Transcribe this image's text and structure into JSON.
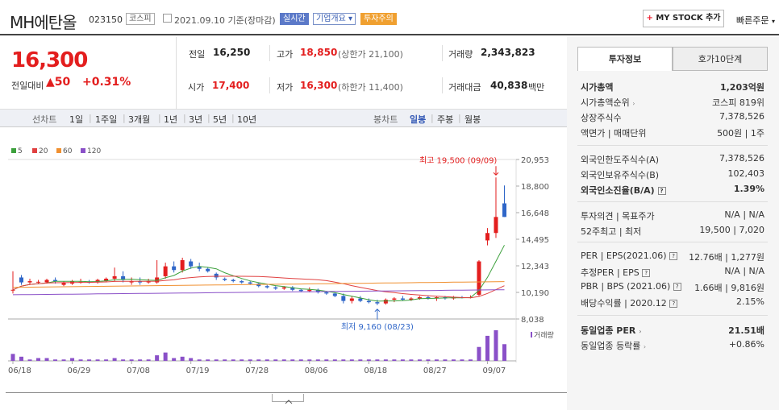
{
  "header": {
    "title": "MH에탄올",
    "code": "023150",
    "market": "코스피",
    "date": "2021.09.10 기준(장마감)",
    "realtime": "실시간",
    "corp_info": "기업개요",
    "caution": "투자주의",
    "mystock_plus": "+",
    "mystock": "MY STOCK 추가",
    "quick_order": "빠른주문"
  },
  "price": {
    "current": "16,300",
    "change_label": "전일대비",
    "change_arrow": "▲",
    "change": "50",
    "change_pct": "+0.31%"
  },
  "quote": {
    "prev_label": "전일",
    "prev": "16,250",
    "high_label": "고가",
    "high": "18,850",
    "high_sub": "(상한가 21,100)",
    "vol_label": "거래량",
    "vol": "2,343,823",
    "open_label": "시가",
    "open": "17,400",
    "low_label": "저가",
    "low": "16,300",
    "low_sub": "(하한가 11,400)",
    "amt_label": "거래대금",
    "amt": "40,838",
    "amt_unit": "백만"
  },
  "periods": {
    "line": "선차트",
    "d1": "1일",
    "w1": "1주일",
    "m3": "3개월",
    "y1": "1년",
    "y3": "3년",
    "y5": "5년",
    "y10": "10년",
    "candle": "봉차트",
    "daily": "일봉",
    "weekly": "주봉",
    "monthly": "월봉"
  },
  "chart_data": {
    "type": "candlestick",
    "ma_legend": [
      "5",
      "20",
      "60",
      "120"
    ],
    "ma_colors": [
      "#3ca03c",
      "#e04040",
      "#f09030",
      "#8a50c8"
    ],
    "y_ticks": [
      "20,953",
      "18,800",
      "16,648",
      "14,495",
      "12,343",
      "10,190",
      "8,038"
    ],
    "x_ticks": [
      "06/18",
      "06/29",
      "07/08",
      "07/19",
      "07/28",
      "08/06",
      "08/18",
      "08/27",
      "09/07"
    ],
    "high_annot": "최고 19,500 (09/09)",
    "low_annot": "최저 9,160 (08/23)",
    "volume_label": "거래량",
    "ylim": [
      8038,
      20953
    ],
    "candles": [
      [
        10400,
        11900,
        10100,
        10400
      ],
      [
        11400,
        11600,
        10800,
        11000
      ],
      [
        11000,
        11300,
        10800,
        11100
      ],
      [
        11000,
        11200,
        10900,
        11050
      ],
      [
        11000,
        11300,
        10900,
        11200
      ],
      [
        11200,
        11400,
        10900,
        11100
      ],
      [
        10800,
        11100,
        10700,
        11000
      ],
      [
        10900,
        11200,
        10800,
        11100
      ],
      [
        11000,
        11300,
        10900,
        11050
      ],
      [
        11050,
        11200,
        10900,
        11000
      ],
      [
        11000,
        11300,
        10900,
        11200
      ],
      [
        11100,
        11400,
        11000,
        11300
      ],
      [
        11300,
        12200,
        11100,
        11500
      ],
      [
        11500,
        11900,
        11000,
        11200
      ],
      [
        11000,
        11400,
        10800,
        11100
      ],
      [
        11100,
        11400,
        10800,
        11000
      ],
      [
        11000,
        11300,
        10900,
        11100
      ],
      [
        11000,
        12800,
        10900,
        11400
      ],
      [
        11500,
        12600,
        11300,
        12300
      ],
      [
        12300,
        12700,
        11800,
        12000
      ],
      [
        12000,
        13000,
        11800,
        12800
      ],
      [
        12700,
        12900,
        12100,
        12300
      ],
      [
        12300,
        12600,
        11900,
        12100
      ],
      [
        12100,
        12200,
        11800,
        11900
      ],
      [
        11700,
        11800,
        11200,
        11400
      ],
      [
        11300,
        11400,
        11100,
        11200
      ],
      [
        11200,
        11300,
        11000,
        11100
      ],
      [
        11100,
        11200,
        10900,
        11000
      ],
      [
        11000,
        11100,
        10800,
        10900
      ],
      [
        10900,
        11000,
        10600,
        10700
      ],
      [
        10700,
        10800,
        10500,
        10600
      ],
      [
        10600,
        10700,
        10400,
        10500
      ],
      [
        10500,
        10700,
        10400,
        10600
      ],
      [
        10600,
        10700,
        10300,
        10400
      ],
      [
        10400,
        10500,
        10200,
        10300
      ],
      [
        10300,
        10600,
        10200,
        10400
      ],
      [
        10400,
        10500,
        10100,
        10200
      ],
      [
        10200,
        10300,
        10000,
        10100
      ],
      [
        10100,
        10200,
        9800,
        9900
      ],
      [
        9900,
        10100,
        9300,
        9500
      ],
      [
        9500,
        9900,
        9300,
        9700
      ],
      [
        9700,
        9900,
        9400,
        9500
      ],
      [
        9500,
        9700,
        9300,
        9400
      ],
      [
        9400,
        9600,
        9160,
        9300
      ],
      [
        9300,
        9700,
        9200,
        9600
      ],
      [
        9600,
        9800,
        9400,
        9700
      ],
      [
        9700,
        9900,
        9500,
        9600
      ],
      [
        9600,
        9800,
        9500,
        9700
      ],
      [
        9700,
        9900,
        9600,
        9800
      ],
      [
        9800,
        9900,
        9600,
        9700
      ],
      [
        9700,
        9900,
        9500,
        9800
      ],
      [
        9800,
        9900,
        9600,
        9700
      ],
      [
        9700,
        9900,
        9600,
        9800
      ],
      [
        9800,
        9900,
        9700,
        9750
      ],
      [
        9750,
        9950,
        9700,
        9800
      ],
      [
        10000,
        12800,
        9900,
        12700
      ],
      [
        14400,
        15400,
        14000,
        15000
      ],
      [
        15000,
        19500,
        14600,
        16300
      ],
      [
        17400,
        18850,
        16300,
        16300
      ]
    ],
    "volumes": [
      5,
      3,
      1,
      2,
      2,
      1,
      1,
      2,
      1,
      1,
      1,
      1,
      2,
      1,
      1,
      1,
      1,
      4,
      6,
      2,
      3,
      2,
      1,
      1,
      1,
      1,
      1,
      1,
      1,
      1,
      1,
      1,
      1,
      1,
      1,
      1,
      1,
      1,
      1,
      1,
      1,
      1,
      1,
      1,
      1,
      1,
      1,
      1,
      1,
      1,
      1,
      1,
      1,
      1,
      1,
      10,
      18,
      22,
      12
    ]
  },
  "sidebar": {
    "tab_info": "투자정보",
    "tab_quote": "호가10단계",
    "mcap_label": "시가총액",
    "mcap": "1,203억원",
    "rank_label": "시가총액순위",
    "rank": "코스피 819위",
    "shares_label": "상장주식수",
    "shares": "7,378,526",
    "par_label": "액면가 | 매매단위",
    "par": "500원 | 1주",
    "foreign_limit_label": "외국인한도주식수(A)",
    "foreign_limit": "7,378,526",
    "foreign_hold_label": "외국인보유주식수(B)",
    "foreign_hold": "102,403",
    "foreign_rate_label": "외국인소진율(B/A)",
    "foreign_rate": "1.39%",
    "opinion_label": "투자의견 | 목표주가",
    "opinion": "N/A | N/A",
    "w52_label": "52주최고 | 최저",
    "w52": "19,500 | 7,020",
    "per_label": "PER | EPS(2021.06)",
    "per": "12.76배 | 1,277원",
    "eper_label": "추정PER | EPS",
    "eper": "N/A | N/A",
    "pbr_label": "PBR | BPS (2021.06)",
    "pbr": "1.66배 | 9,816원",
    "div_label": "배당수익률 | 2020.12",
    "div": "2.15%",
    "sector_per_label": "동일업종 PER",
    "sector_per": "21.51배",
    "sector_rate_label": "동일업종 등락률",
    "sector_rate": "+0.86%"
  }
}
